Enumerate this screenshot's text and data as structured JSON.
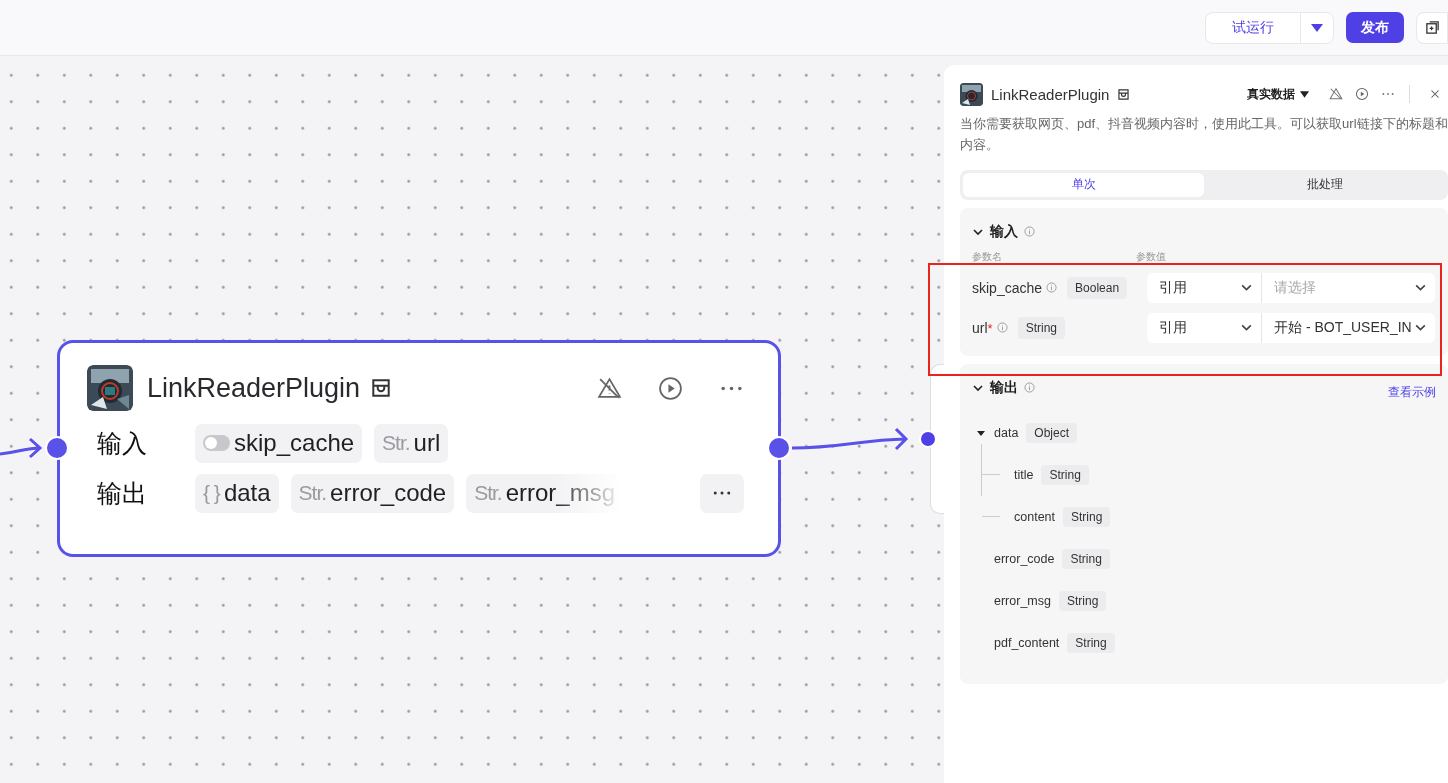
{
  "toolbar": {
    "test_run": "试运行",
    "publish": "发布"
  },
  "node": {
    "title": "LinkReaderPlugin",
    "input_label": "输入",
    "inputs": [
      {
        "kind": "boolean",
        "name": "skip_cache"
      },
      {
        "kind": "string",
        "prefix": "Str.",
        "name": "url"
      }
    ],
    "output_label": "输出",
    "outputs": [
      {
        "prefix": "{ }",
        "name": "data",
        "faded": false
      },
      {
        "prefix": "Str.",
        "name": "error_code",
        "faded": false
      },
      {
        "prefix": "Str.",
        "name": "error_msg",
        "faded": true
      }
    ]
  },
  "panel": {
    "title": "LinkReaderPlugin",
    "data_source": "真实数据",
    "description": "当你需要获取网页、pdf、抖音视频内容时，使用此工具。可以获取url链接下的标题和内容。",
    "tabs": [
      {
        "label": "单次",
        "selected": true
      },
      {
        "label": "批处理",
        "selected": false
      }
    ],
    "input_section": {
      "title": "输入",
      "expanded": true,
      "column_1": "参数名",
      "column_2": "参数值",
      "highlighted": true,
      "params": [
        {
          "name": "skip_cache",
          "type": "Boolean",
          "mode": "引用",
          "placeholder": "请选择"
        },
        {
          "name": "url",
          "required_mark": "*",
          "type": "String",
          "mode": "引用",
          "value": "开始 - BOT_USER_IN"
        }
      ]
    },
    "output_section": {
      "title": "输出",
      "expanded": true,
      "link": "查看示例",
      "tree": [
        {
          "name": "data",
          "type": "Object",
          "expanded": true,
          "children": [
            {
              "name": "title",
              "type": "String"
            },
            {
              "name": "content",
              "type": "String"
            }
          ]
        },
        {
          "name": "error_code",
          "type": "String"
        },
        {
          "name": "error_msg",
          "type": "String"
        },
        {
          "name": "pdf_content",
          "type": "String"
        }
      ]
    }
  }
}
